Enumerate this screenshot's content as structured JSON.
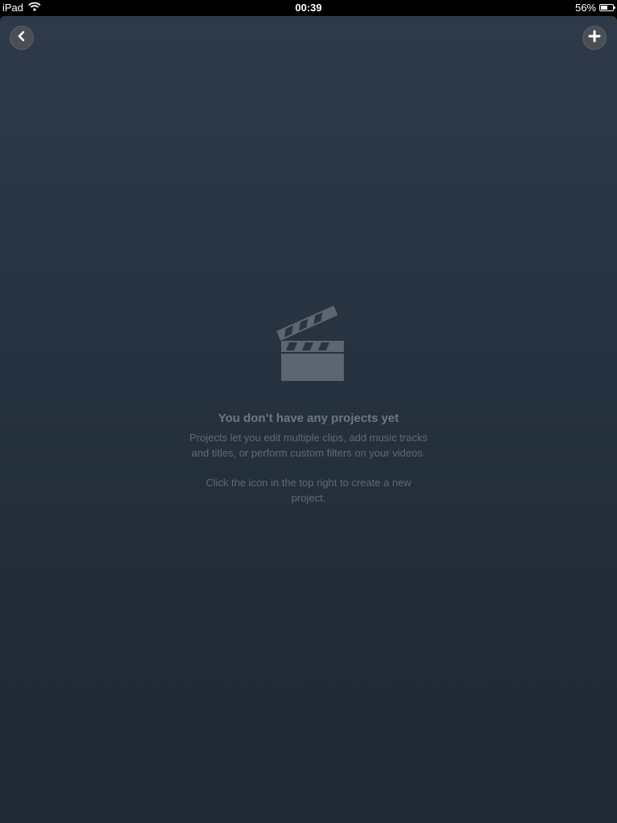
{
  "status_bar": {
    "device": "iPad",
    "time": "00:39",
    "battery_text": "56%",
    "battery_level": 0.56
  },
  "toolbar": {
    "back_icon": "chevron-left-icon",
    "add_icon": "plus-icon"
  },
  "empty_state": {
    "icon": "clapperboard-icon",
    "title": "You don’t have any projects yet",
    "description": "Projects let you edit multiple clips, add music tracks and titles, or perform custom filters on your videos.",
    "hint": "Click the icon in the top right to create a new project."
  },
  "colors": {
    "background_top": "#2e3a4a",
    "background_bottom": "#1f2834",
    "muted_text": "#6d7685",
    "icon_fill": "#5c6572"
  }
}
